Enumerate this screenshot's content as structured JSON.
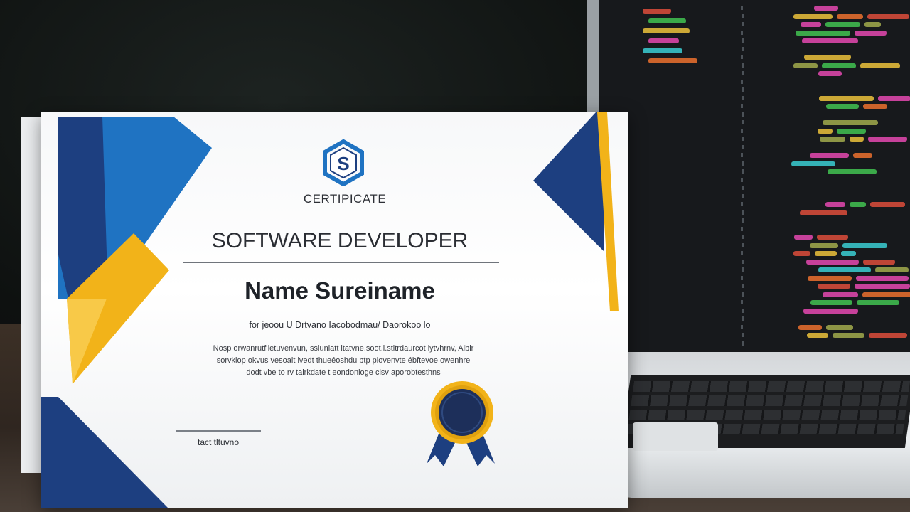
{
  "certificate": {
    "heading": "CERTIPICATE",
    "title": "SOFTWARE DEVELOPER",
    "recipient": "Name Sureiname",
    "subtitle": "for jeoou U Drtvano Iacobodmau/ Daorokoo lo",
    "body_lines": [
      "Nosp orwanrutfiletuvenvun, ssiunlatt itatvne.soot.i.stitrdaurcot lytvhrnv, Albir",
      "sorvkiop okvus vesoait lvedt thueéoshdu btp plovenvte ébftevoe owenhre",
      "dodt vbe to rv tairkdate t eondonioge clsv aporobtesthns"
    ],
    "signature_label": "tact tltuvno",
    "logo_icon": "hexagon-s-logo-icon",
    "seal_icon": "award-seal-icon",
    "colors": {
      "navy": "#1d3f80",
      "blue": "#1f73c2",
      "gold": "#f2b319",
      "paper": "#ffffff",
      "code_bg": "#17191c"
    }
  }
}
